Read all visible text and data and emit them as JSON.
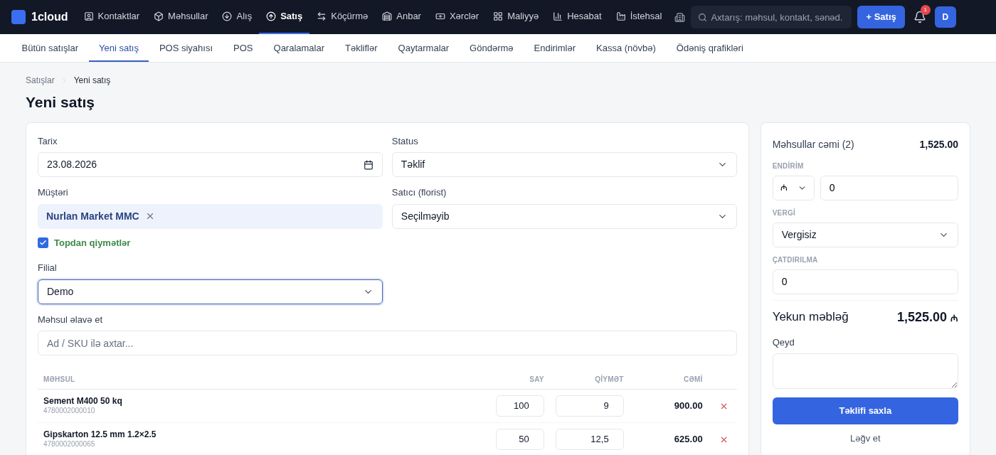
{
  "brand": "1cloud",
  "nav": [
    {
      "label": "Kontaktlar",
      "selected": false
    },
    {
      "label": "Məhsullar",
      "selected": false
    },
    {
      "label": "Alış",
      "selected": false
    },
    {
      "label": "Satış",
      "selected": true
    },
    {
      "label": "Köçürmə",
      "selected": false
    },
    {
      "label": "Anbar",
      "selected": false
    },
    {
      "label": "Xərclər",
      "selected": false
    },
    {
      "label": "Maliyyə",
      "selected": false
    },
    {
      "label": "Hesabat",
      "selected": false
    },
    {
      "label": "İstehsal",
      "selected": false
    }
  ],
  "search": {
    "placeholder": "Axtarış: məhsul, kontakt, sənəd."
  },
  "new_button": "+ Satış",
  "notifications": "1",
  "avatar": "D",
  "subnav": [
    {
      "label": "Bütün satışlar",
      "selected": false
    },
    {
      "label": "Yeni satış",
      "selected": true
    },
    {
      "label": "POS siyahısı",
      "selected": false
    },
    {
      "label": "POS",
      "selected": false
    },
    {
      "label": "Qaralamalar",
      "selected": false
    },
    {
      "label": "Təkliflər",
      "selected": false
    },
    {
      "label": "Qaytarmalar",
      "selected": false
    },
    {
      "label": "Göndərmə",
      "selected": false
    },
    {
      "label": "Endirimlər",
      "selected": false
    },
    {
      "label": "Kassa (növbə)",
      "selected": false
    },
    {
      "label": "Ödəniş qrafikləri",
      "selected": false
    }
  ],
  "breadcrumb": [
    "Satışlar",
    "Yeni satış"
  ],
  "title": "Yeni satış",
  "form": {
    "date": {
      "label": "Tarix",
      "value": "23.08.2026"
    },
    "status": {
      "label": "Status",
      "value": "Təklif"
    },
    "customer": {
      "label": "Müştəri",
      "value": "Nurlan Market MMC"
    },
    "seller": {
      "label": "Satıcı (florist)",
      "value": "Seçilməyib"
    },
    "wholesale": {
      "label": "Topdan qiymətlər",
      "checked": true
    },
    "branch": {
      "label": "Filial",
      "value": "Demo"
    },
    "add_product": {
      "label": "Məhsul əlavə et",
      "placeholder": "Ad / SKU ilə axtar..."
    }
  },
  "table": {
    "columns": [
      "MƏHSUL",
      "SAY",
      "QİYMƏT",
      "CƏMİ"
    ],
    "rows": [
      {
        "name": "Sement M400 50 kq",
        "sku": "4780002000010",
        "qty": "100",
        "price": "9",
        "total": "900.00"
      },
      {
        "name": "Gipskarton 12.5 mm 1.2×2.5",
        "sku": "4780002000065",
        "qty": "50",
        "price": "12,5",
        "total": "625.00"
      }
    ]
  },
  "summary": {
    "subtotal_label": "Məhsullar cəmi (2)",
    "subtotal": "1,525.00",
    "discount_label": "ENDİRİM",
    "discount_type": "₼",
    "discount_value": "0",
    "tax_label": "VERGİ",
    "tax_value": "Vergisiz",
    "delivery_label": "ÇATDIRILMA",
    "delivery_value": "0",
    "total_label": "Yekun məbləğ",
    "total": "1,525.00",
    "currency": "₼",
    "note_label": "Qeyd",
    "save_button": "Təklifi saxla",
    "cancel_link": "Ləğv et"
  }
}
